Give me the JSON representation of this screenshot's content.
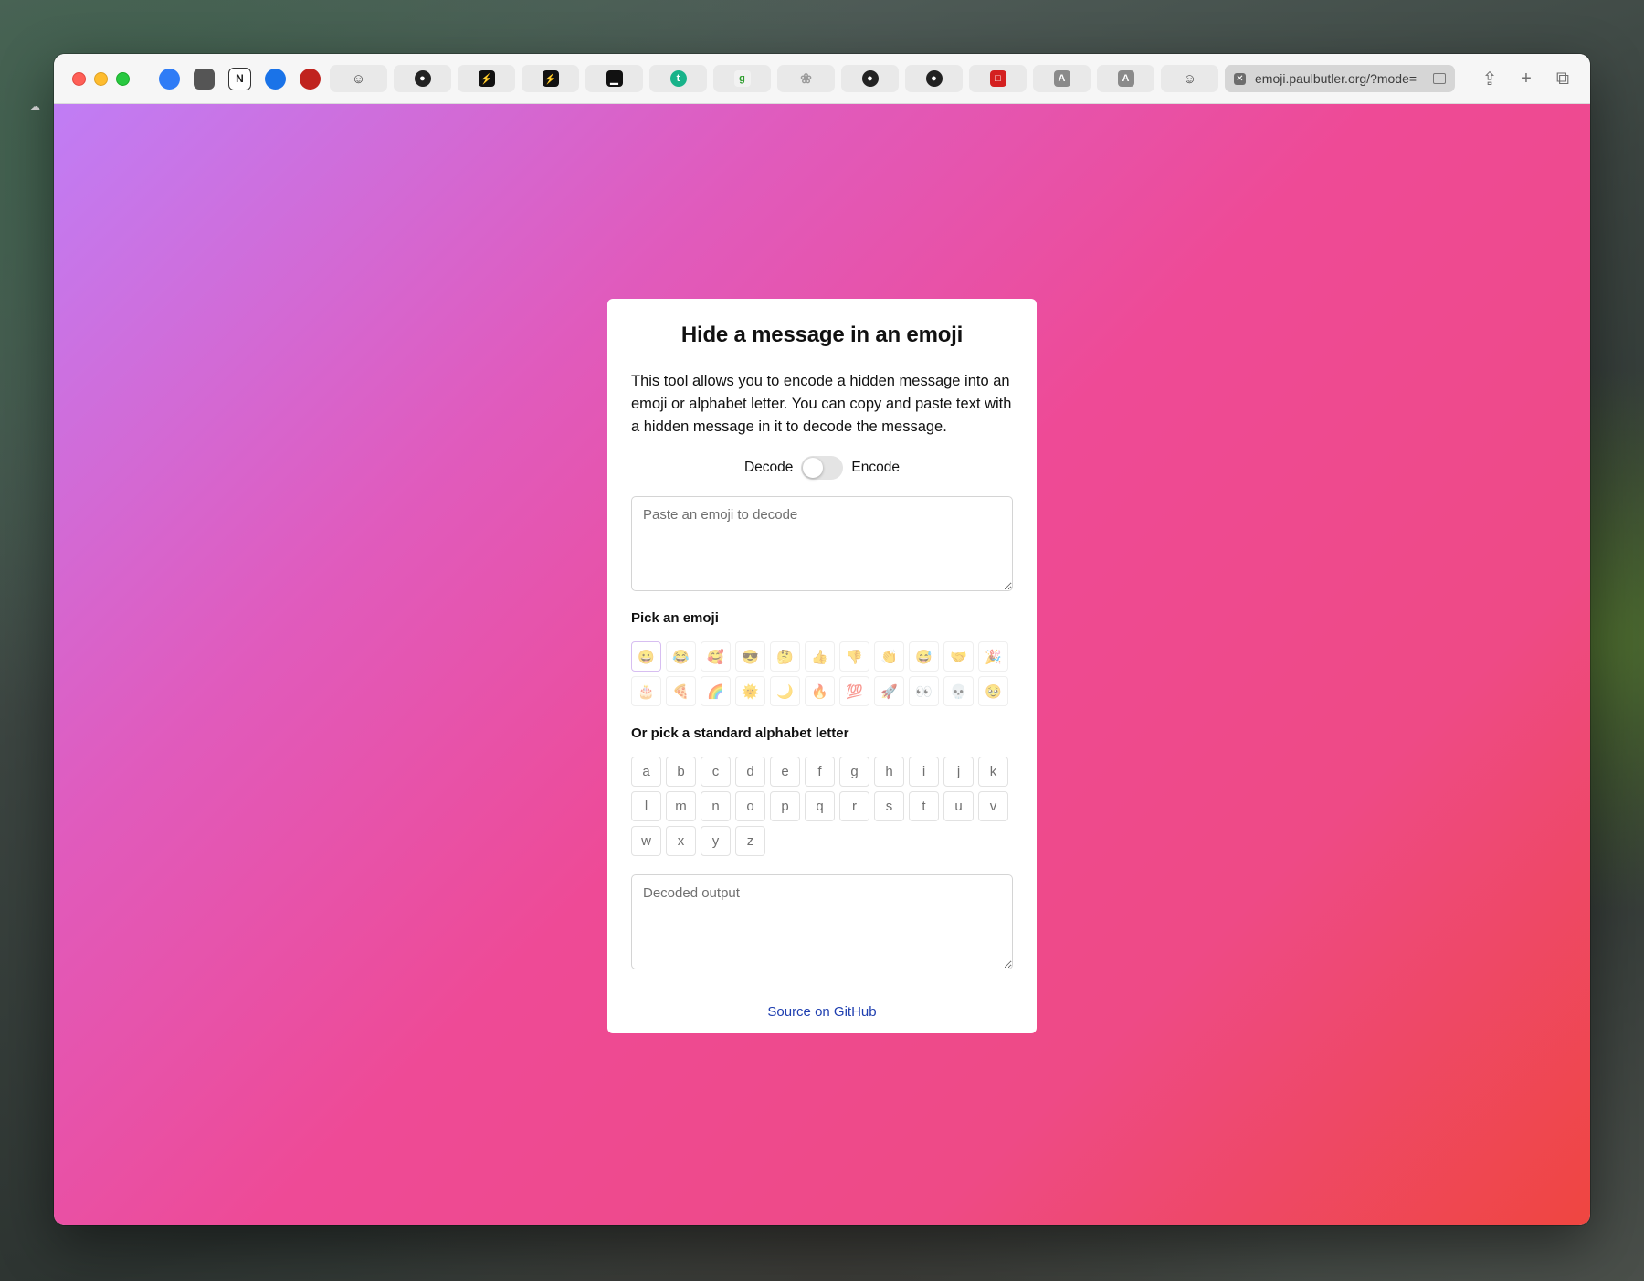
{
  "browser": {
    "active_tab_url": "emoji.paulbutler.org/?mode=",
    "pinned_tabs": [
      {
        "icon": "blue-circle-app-icon",
        "color": "#2f7cf6",
        "glyph": ""
      },
      {
        "icon": "shield-icon",
        "color": "#555",
        "glyph": ""
      },
      {
        "icon": "notion-icon",
        "color": "#fff",
        "glyph": "N"
      },
      {
        "icon": "password-icon",
        "color": "#1a73e8",
        "glyph": ""
      },
      {
        "icon": "red-record-icon",
        "color": "#c0231e",
        "glyph": ""
      }
    ],
    "tabs": [
      {
        "icon": "avatar-icon",
        "color": "#444",
        "glyph": "☺"
      },
      {
        "icon": "github-icon",
        "color": "#222",
        "glyph": "●"
      },
      {
        "icon": "bolt-icon",
        "color": "#111",
        "glyph": "⚡"
      },
      {
        "icon": "bolt-icon",
        "color": "#111",
        "glyph": "⚡"
      },
      {
        "icon": "terminal-icon",
        "color": "#111",
        "glyph": "▁"
      },
      {
        "icon": "teal-circle-icon",
        "color": "#18b38a",
        "glyph": "t"
      },
      {
        "icon": "green-g-icon",
        "color": "#f2f2f2",
        "glyph": "g"
      },
      {
        "icon": "figure-icon",
        "color": "#9a9a9a",
        "glyph": "❀"
      },
      {
        "icon": "github-icon",
        "color": "#222",
        "glyph": "●"
      },
      {
        "icon": "github-icon",
        "color": "#222",
        "glyph": "●"
      },
      {
        "icon": "red-box-icon",
        "color": "#d42020",
        "glyph": "□"
      },
      {
        "icon": "letter-a-icon",
        "color": "#8a8a8a",
        "glyph": "A"
      },
      {
        "icon": "letter-a-icon",
        "color": "#8a8a8a",
        "glyph": "A"
      },
      {
        "icon": "avatar-icon",
        "color": "#444",
        "glyph": "☺"
      }
    ]
  },
  "page": {
    "title": "Hide a message in an emoji",
    "description": "This tool allows you to encode a hidden message into an emoji or alphabet letter. You can copy and paste text with a hidden message in it to decode the message.",
    "toggle": {
      "left_label": "Decode",
      "right_label": "Encode",
      "state": "decode"
    },
    "input_placeholder": "Paste an emoji to decode",
    "emoji_label": "Pick an emoji",
    "emojis": [
      "😀",
      "😂",
      "🥰",
      "😎",
      "🤔",
      "👍",
      "👎",
      "👏",
      "😅",
      "🤝",
      "🎉",
      "🎂",
      "🍕",
      "🌈",
      "🌞",
      "🌙",
      "🔥",
      "💯",
      "🚀",
      "👀",
      "💀",
      "🥹"
    ],
    "selected_emoji_index": 0,
    "letters_label": "Or pick a standard alphabet letter",
    "letters": [
      "a",
      "b",
      "c",
      "d",
      "e",
      "f",
      "g",
      "h",
      "i",
      "j",
      "k",
      "l",
      "m",
      "n",
      "o",
      "p",
      "q",
      "r",
      "s",
      "t",
      "u",
      "v",
      "w",
      "x",
      "y",
      "z"
    ],
    "output_placeholder": "Decoded output",
    "footer_link": "Source on GitHub"
  }
}
